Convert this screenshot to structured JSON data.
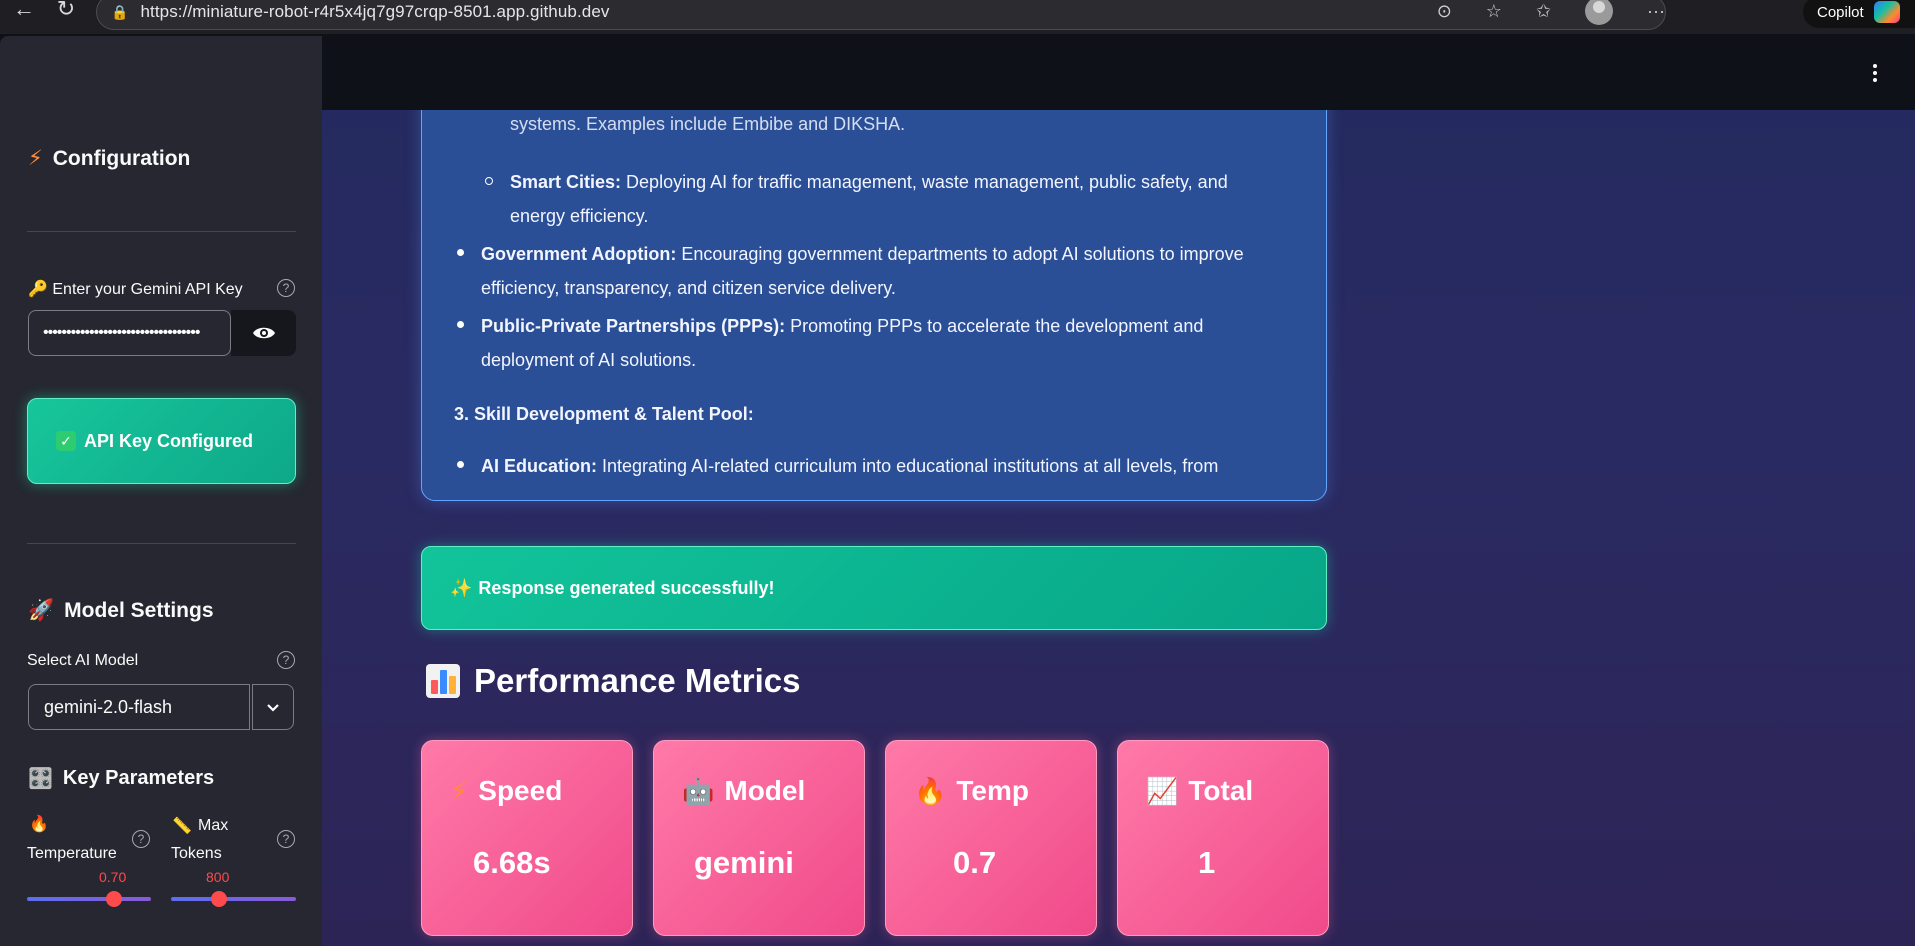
{
  "browser": {
    "url": "https://miniature-robot-r4r5x4jq7g97crqp-8501.app.github.dev",
    "copilot_label": "Copilot"
  },
  "sidebar": {
    "configuration_title": "Configuration",
    "api_key_label": "🔑 Enter your Gemini API Key",
    "api_key_value": "••••••••••••••••••••••••••••••••••",
    "api_status": "API Key Configured",
    "model_settings_title": "Model Settings",
    "select_model_label": "Select AI Model",
    "selected_model": "gemini-2.0-flash",
    "key_parameters_title": "Key Parameters",
    "temperature": {
      "label": "Temperature",
      "value": "0.70",
      "fraction": 0.7
    },
    "max_tokens": {
      "label_line1": "Max",
      "label_line2": "Tokens",
      "value": "800",
      "fraction": 0.39
    }
  },
  "response": {
    "partial_line": "systems. Examples include Embibe and DIKSHA.",
    "items": [
      {
        "bold": "Smart Cities:",
        "text_line1": " Deploying AI for traffic management, waste management, public safety, and",
        "text_line2": "energy efficiency."
      },
      {
        "bold": "Government Adoption:",
        "text_line1": " Encouraging government departments to adopt AI solutions to improve",
        "text_line2": "efficiency, transparency, and citizen service delivery."
      },
      {
        "bold": "Public-Private Partnerships (PPPs):",
        "text_line1": " Promoting PPPs to accelerate the development and",
        "text_line2": "deployment of AI solutions."
      }
    ],
    "section_heading": "3. Skill Development & Talent Pool:",
    "last_item": {
      "bold": "AI Education:",
      "text": " Integrating AI-related curriculum into educational institutions at all levels, from"
    }
  },
  "success_message": "Response generated successfully!",
  "metrics": {
    "title": "Performance Metrics",
    "cards": [
      {
        "label": "Speed",
        "value": "6.68s",
        "icon": "lightning-icon"
      },
      {
        "label": "Model",
        "value": "gemini",
        "icon": "robot-icon"
      },
      {
        "label": "Temp",
        "value": "0.7",
        "icon": "fire-icon"
      },
      {
        "label": "Total",
        "value": "1",
        "icon": "chart-up-icon"
      }
    ]
  },
  "colors": {
    "accent_green": "#12c49a",
    "metric_pink": "#f04a8a",
    "response_blue": "#2a4f97",
    "slider_red": "#ff4b4b"
  }
}
